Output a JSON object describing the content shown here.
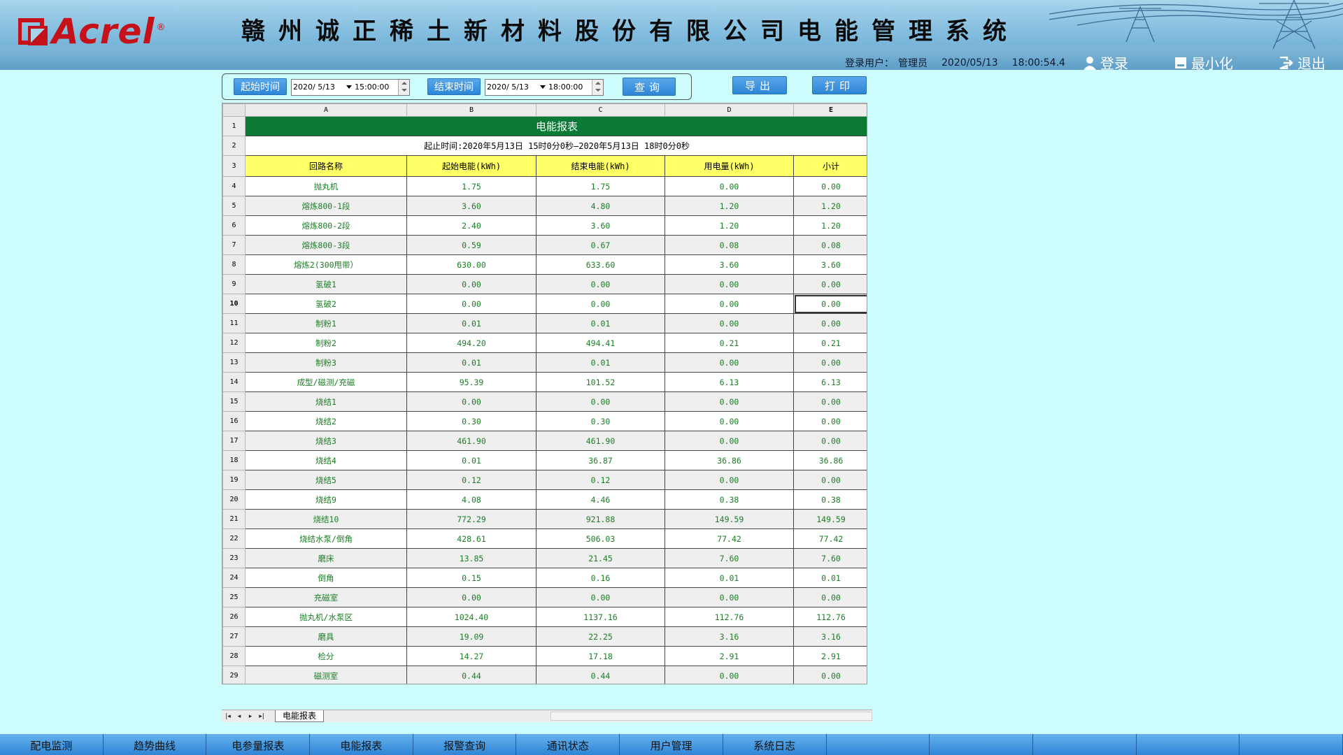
{
  "brand": {
    "name": "Acrel",
    "reg": "®",
    "colors": {
      "logo": "#c5121a",
      "header": "#7db9dc",
      "accent": "#2d86d6",
      "table_title_bg": "#0b7a35",
      "table_header_bg": "#ffff66",
      "value_text": "#1b7e24"
    }
  },
  "header": {
    "title": "赣州诚正稀土新材料股份有限公司电能管理系统",
    "login_user_label": "登录用户：",
    "user_name": "管理员",
    "date": "2020/05/13",
    "time": "18:00:54.4",
    "buttons": [
      {
        "label": "登录",
        "icon": "user-icon"
      },
      {
        "label": "最小化",
        "icon": "minimize-icon"
      },
      {
        "label": "退出",
        "icon": "exit-icon"
      }
    ]
  },
  "query": {
    "start_label": "起始时间",
    "start_date": "2020/ 5/13",
    "start_time": "15:00:00",
    "end_label": "结束时间",
    "end_date": "2020/ 5/13",
    "end_time": "18:00:00",
    "query_button": "查询",
    "export_button": "导出",
    "print_button": "打印"
  },
  "sheet": {
    "columns": [
      "A",
      "B",
      "C",
      "D",
      "E"
    ],
    "title": "电能报表",
    "range_text": "起止时间:2020年5月13日 15时0分0秒—2020年5月13日 18时0分0秒",
    "headers": [
      "回路名称",
      "起始电能(kWh)",
      "结束电能(kWh)",
      "用电量(kWh)",
      "小计"
    ],
    "rows": [
      {
        "n": "4",
        "name": "抛丸机",
        "start": "1.75",
        "end": "1.75",
        "usage": "0.00",
        "subtotal": "0.00"
      },
      {
        "n": "5",
        "name": "熔炼800-1段",
        "start": "3.60",
        "end": "4.80",
        "usage": "1.20",
        "subtotal": "1.20"
      },
      {
        "n": "6",
        "name": "熔炼800-2段",
        "start": "2.40",
        "end": "3.60",
        "usage": "1.20",
        "subtotal": "1.20"
      },
      {
        "n": "7",
        "name": "熔炼800-3段",
        "start": "0.59",
        "end": "0.67",
        "usage": "0.08",
        "subtotal": "0.08"
      },
      {
        "n": "8",
        "name": "熔炼2(300甩带）",
        "start": "630.00",
        "end": "633.60",
        "usage": "3.60",
        "subtotal": "3.60"
      },
      {
        "n": "9",
        "name": "氢破1",
        "start": "0.00",
        "end": "0.00",
        "usage": "0.00",
        "subtotal": "0.00"
      },
      {
        "n": "10",
        "name": "氢破2",
        "start": "0.00",
        "end": "0.00",
        "usage": "0.00",
        "subtotal": "0.00"
      },
      {
        "n": "11",
        "name": "制粉1",
        "start": "0.01",
        "end": "0.01",
        "usage": "0.00",
        "subtotal": "0.00"
      },
      {
        "n": "12",
        "name": "制粉2",
        "start": "494.20",
        "end": "494.41",
        "usage": "0.21",
        "subtotal": "0.21"
      },
      {
        "n": "13",
        "name": "制粉3",
        "start": "0.01",
        "end": "0.01",
        "usage": "0.00",
        "subtotal": "0.00"
      },
      {
        "n": "14",
        "name": "成型/磁测/充磁",
        "start": "95.39",
        "end": "101.52",
        "usage": "6.13",
        "subtotal": "6.13"
      },
      {
        "n": "15",
        "name": "烧结1",
        "start": "0.00",
        "end": "0.00",
        "usage": "0.00",
        "subtotal": "0.00"
      },
      {
        "n": "16",
        "name": "烧结2",
        "start": "0.30",
        "end": "0.30",
        "usage": "0.00",
        "subtotal": "0.00"
      },
      {
        "n": "17",
        "name": "烧结3",
        "start": "461.90",
        "end": "461.90",
        "usage": "0.00",
        "subtotal": "0.00"
      },
      {
        "n": "18",
        "name": "烧结4",
        "start": "0.01",
        "end": "36.87",
        "usage": "36.86",
        "subtotal": "36.86"
      },
      {
        "n": "19",
        "name": "烧结5",
        "start": "0.12",
        "end": "0.12",
        "usage": "0.00",
        "subtotal": "0.00"
      },
      {
        "n": "20",
        "name": "烧结9",
        "start": "4.08",
        "end": "4.46",
        "usage": "0.38",
        "subtotal": "0.38"
      },
      {
        "n": "21",
        "name": "烧结10",
        "start": "772.29",
        "end": "921.88",
        "usage": "149.59",
        "subtotal": "149.59"
      },
      {
        "n": "22",
        "name": "烧结水泵/倒角",
        "start": "428.61",
        "end": "506.03",
        "usage": "77.42",
        "subtotal": "77.42"
      },
      {
        "n": "23",
        "name": "磨床",
        "start": "13.85",
        "end": "21.45",
        "usage": "7.60",
        "subtotal": "7.60"
      },
      {
        "n": "24",
        "name": "倒角",
        "start": "0.15",
        "end": "0.16",
        "usage": "0.01",
        "subtotal": "0.01"
      },
      {
        "n": "25",
        "name": "充磁室",
        "start": "0.00",
        "end": "0.00",
        "usage": "0.00",
        "subtotal": "0.00"
      },
      {
        "n": "26",
        "name": "抛丸机/水泵区",
        "start": "1024.40",
        "end": "1137.16",
        "usage": "112.76",
        "subtotal": "112.76"
      },
      {
        "n": "27",
        "name": "磨具",
        "start": "19.09",
        "end": "22.25",
        "usage": "3.16",
        "subtotal": "3.16"
      },
      {
        "n": "28",
        "name": "检分",
        "start": "14.27",
        "end": "17.18",
        "usage": "2.91",
        "subtotal": "2.91"
      },
      {
        "n": "29",
        "name": "磁测室",
        "start": "0.44",
        "end": "0.44",
        "usage": "0.00",
        "subtotal": "0.00"
      }
    ],
    "tab_name": "电能报表",
    "selected_row": "10"
  },
  "nav": {
    "items": [
      "配电监测",
      "趋势曲线",
      "电参量报表",
      "电能报表",
      "报警查询",
      "通讯状态",
      "用户管理",
      "系统日志",
      "",
      "",
      "",
      "",
      ""
    ]
  }
}
